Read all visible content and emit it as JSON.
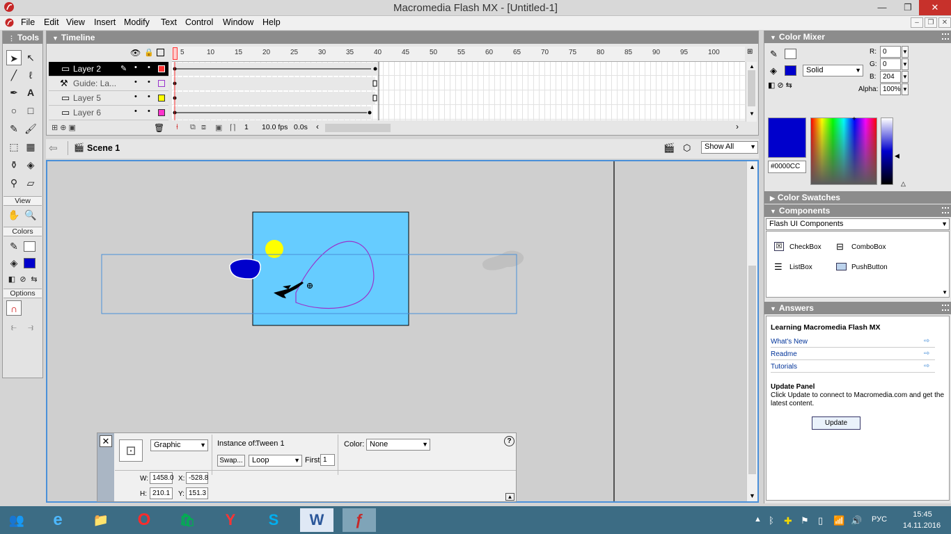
{
  "window": {
    "title": "Macromedia Flash MX - [Untitled-1]",
    "minimize": "—",
    "maximize": "❐",
    "close": "✕"
  },
  "menu": [
    "File",
    "Edit",
    "View",
    "Insert",
    "Modify",
    "Text",
    "Control",
    "Window",
    "Help"
  ],
  "tools_panel": {
    "title": "Tools",
    "sections": {
      "view": "View",
      "colors": "Colors",
      "options": "Options"
    }
  },
  "timeline": {
    "title": "Timeline",
    "layers": [
      {
        "name": "Layer 2",
        "selected": true,
        "color": "#ff3333"
      },
      {
        "name": "Guide: La...",
        "selected": false,
        "color": "#9933cc"
      },
      {
        "name": "Layer 5",
        "selected": false,
        "color": "#ffff00"
      },
      {
        "name": "Layer 6",
        "selected": false,
        "color": "#ff33cc"
      }
    ],
    "ruler": [
      "1",
      "5",
      "10",
      "15",
      "20",
      "25",
      "30",
      "35",
      "40",
      "45",
      "50",
      "55",
      "60",
      "65",
      "70",
      "75",
      "80",
      "85",
      "90",
      "95",
      "100"
    ],
    "current_frame": "1",
    "fps": "10.0 fps",
    "time": "0.0s"
  },
  "scene": {
    "name": "Scene 1",
    "zoom": "Show All"
  },
  "properties": {
    "symbol_type": "Graphic",
    "instance_of_label": "Instance of:",
    "instance_of_value": "Tween 1",
    "swap_label": "Swap...",
    "loop": "Loop",
    "first_label": "First:",
    "first_value": "1",
    "color_label": "Color:",
    "color_value": "None",
    "w_label": "W:",
    "w": "1458.0",
    "x_label": "X:",
    "x": "-528.8",
    "h_label": "H:",
    "h": "210.1",
    "y_label": "Y:",
    "y": "151.3",
    "help": "?"
  },
  "color_mixer": {
    "title": "Color Mixer",
    "r_label": "R:",
    "r": "0",
    "g_label": "G:",
    "g": "0",
    "b_label": "B:",
    "b": "204",
    "alpha_label": "Alpha:",
    "alpha": "100%",
    "fill_type": "Solid",
    "hex": "#0000CC",
    "fill_color": "#0000cc"
  },
  "color_swatches": {
    "title": "Color Swatches"
  },
  "components": {
    "title": "Components",
    "set": "Flash UI Components",
    "items": [
      "CheckBox",
      "ComboBox",
      "ListBox",
      "PushButton"
    ]
  },
  "answers": {
    "title": "Answers",
    "heading": "Learning Macromedia Flash MX",
    "links": [
      "What's New",
      "Readme",
      "Tutorials"
    ],
    "update_title": "Update Panel",
    "update_text": "Click Update to connect to Macromedia.com and get the latest content.",
    "update_button": "Update"
  },
  "taskbar": {
    "lang": "РУС",
    "time": "15:45",
    "date": "14.11.2016"
  }
}
